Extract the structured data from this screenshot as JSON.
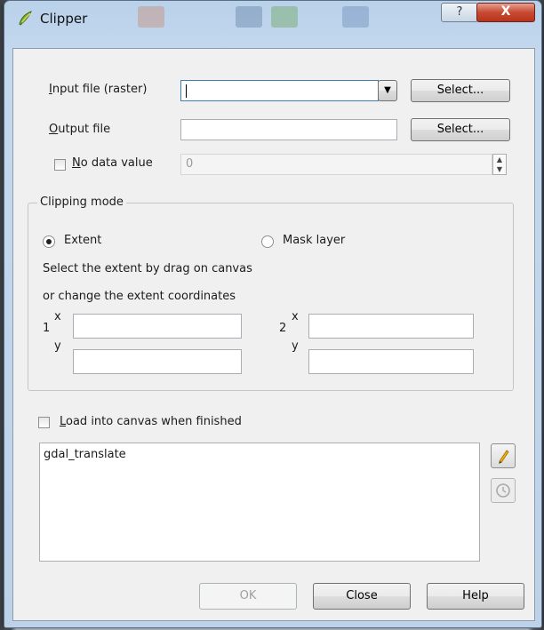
{
  "window": {
    "title": "Clipper",
    "help_label": "?",
    "close_label": "X",
    "app_icon": "qgis-clipper-icon"
  },
  "form": {
    "input_label": "Input file (raster)",
    "input_underline": "I",
    "input_rest": "nput file (raster)",
    "input_value": "",
    "input_select": "Select...",
    "output_label": "Output file",
    "output_underline": "O",
    "output_rest": "utput file",
    "output_value": "",
    "output_select": "Select...",
    "nodata_underline": "N",
    "nodata_rest": "o data value",
    "nodata_value": "0"
  },
  "clipping": {
    "title": "Clipping mode",
    "extent_label": "Extent",
    "extent_selected": true,
    "mask_label": "Mask layer",
    "mask_selected": false,
    "hint1": "Select the extent by drag on canvas",
    "hint2": "or change the extent coordinates",
    "p1_label": "1",
    "p2_label": "2",
    "x_label": "x",
    "y_label": "y",
    "x1": "",
    "y1": "",
    "x2": "",
    "y2": ""
  },
  "load": {
    "underline": "L",
    "rest": "oad into canvas when finished",
    "checked": false
  },
  "command": {
    "text": "gdal_translate",
    "edit_icon": "pencil-icon",
    "reset_icon": "reset-icon"
  },
  "buttons": {
    "ok": "OK",
    "close": "Close",
    "help": "Help"
  },
  "colors": {
    "titlebar": "#bdd2e8",
    "close_button": "#c74a33",
    "dialog_bg": "#f0f0f0"
  }
}
